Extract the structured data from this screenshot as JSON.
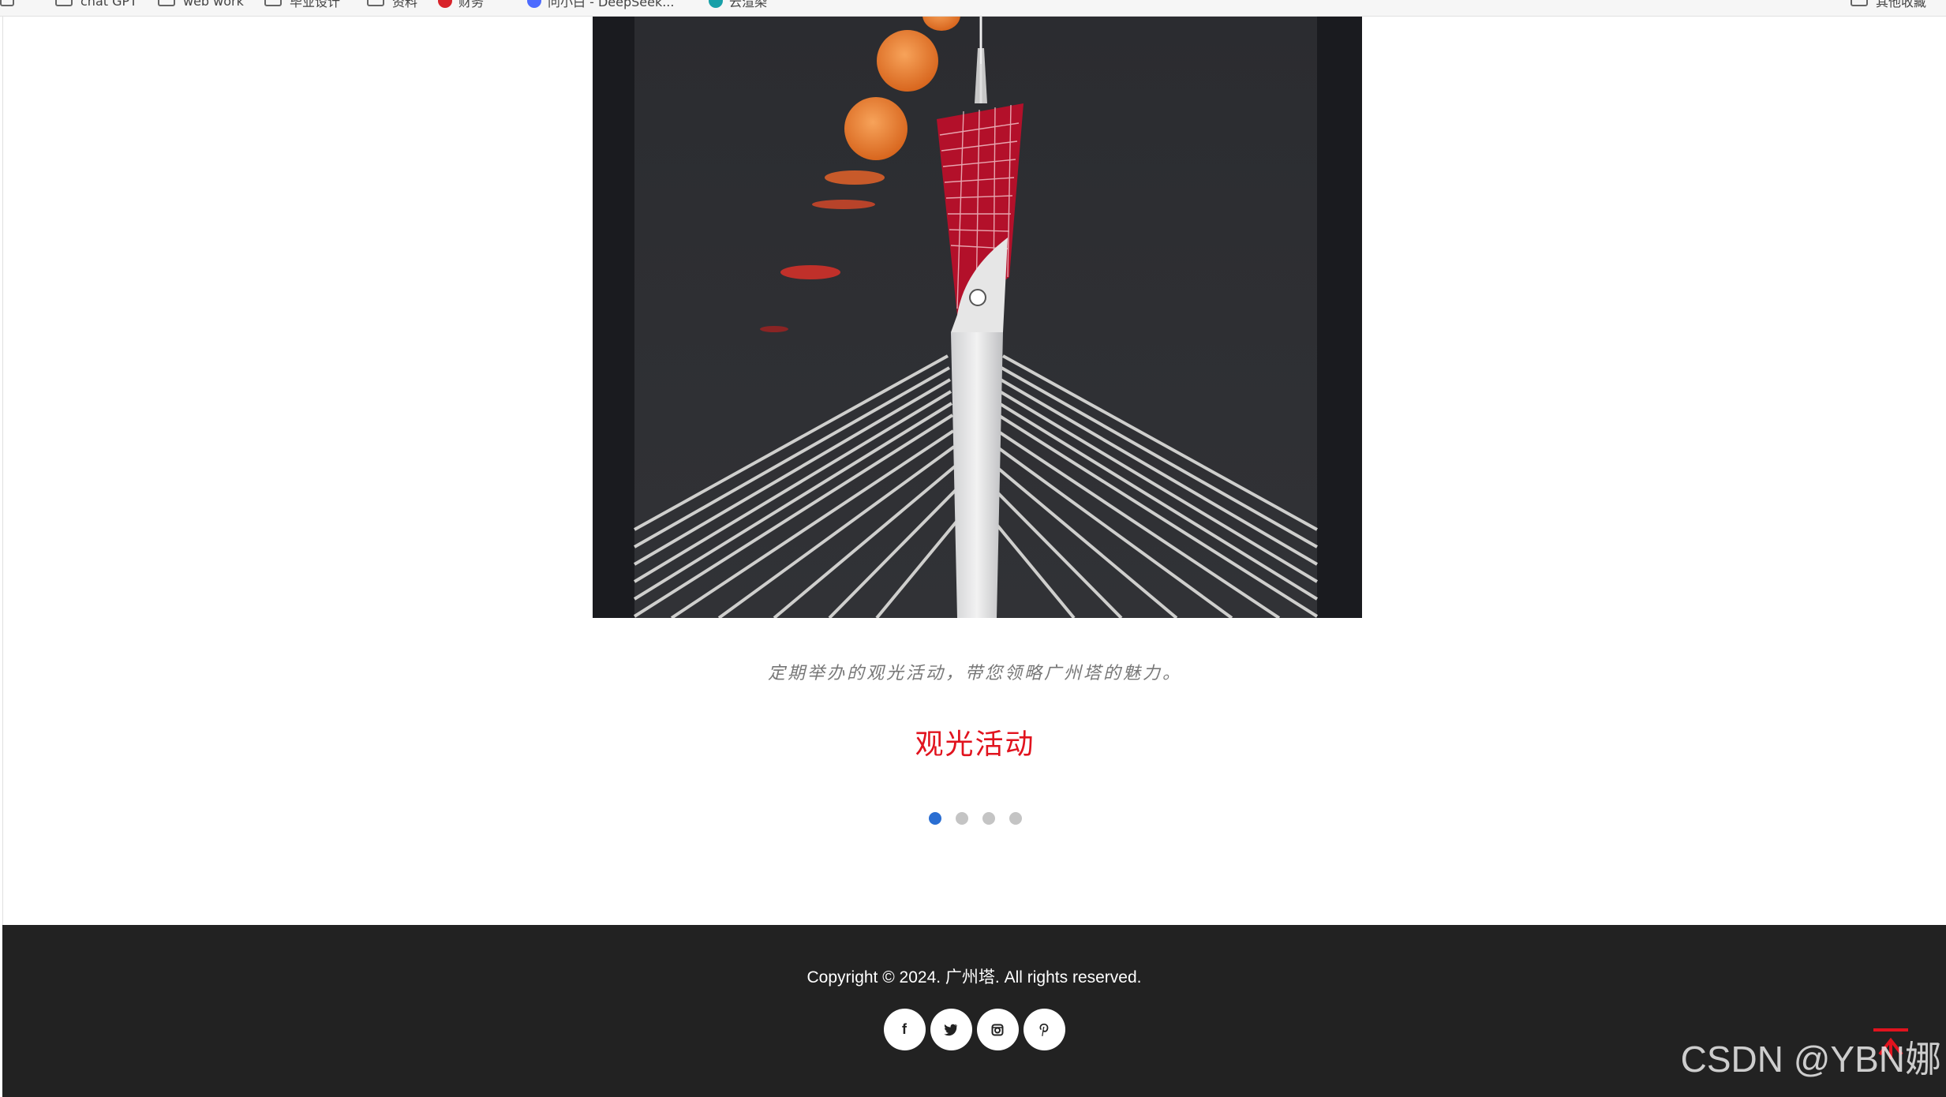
{
  "bookmarks": [
    {
      "label": "chat GPT",
      "icon": "folder-icon"
    },
    {
      "label": "web work",
      "icon": "folder-icon"
    },
    {
      "label": "毕业设计",
      "icon": "folder-icon"
    },
    {
      "label": "资料",
      "icon": "folder-icon"
    },
    {
      "label": "财务",
      "icon": "bookmark-favicon"
    },
    {
      "label": "问小白 - DeepSeek...",
      "icon": "deepseek-favicon"
    },
    {
      "label": "云渲染",
      "icon": "bookmark-favicon"
    },
    {
      "label": "其他收藏",
      "icon": "folder-icon"
    }
  ],
  "hero": {
    "image_alt": "Canton Tower at night with moonrise sequence"
  },
  "carousel": {
    "caption": "定期举办的观光活动，带您领略广州塔的魅力。",
    "title": "观光活动",
    "dots_total": 4,
    "active_index": 0
  },
  "footer": {
    "copyright": "Copyright © 2024. 广州塔. All rights reserved.",
    "social": [
      {
        "icon": "facebook-icon",
        "glyph": "f"
      },
      {
        "icon": "twitter-icon",
        "glyph": "t"
      },
      {
        "icon": "instagram-icon",
        "glyph": "◘"
      },
      {
        "icon": "pinterest-icon",
        "glyph": "p"
      }
    ]
  },
  "watermark": "CSDN @YBN娜",
  "colors": {
    "title": "#e1131e",
    "active_dot": "#2a6ed2",
    "footer_bg": "#222222"
  }
}
